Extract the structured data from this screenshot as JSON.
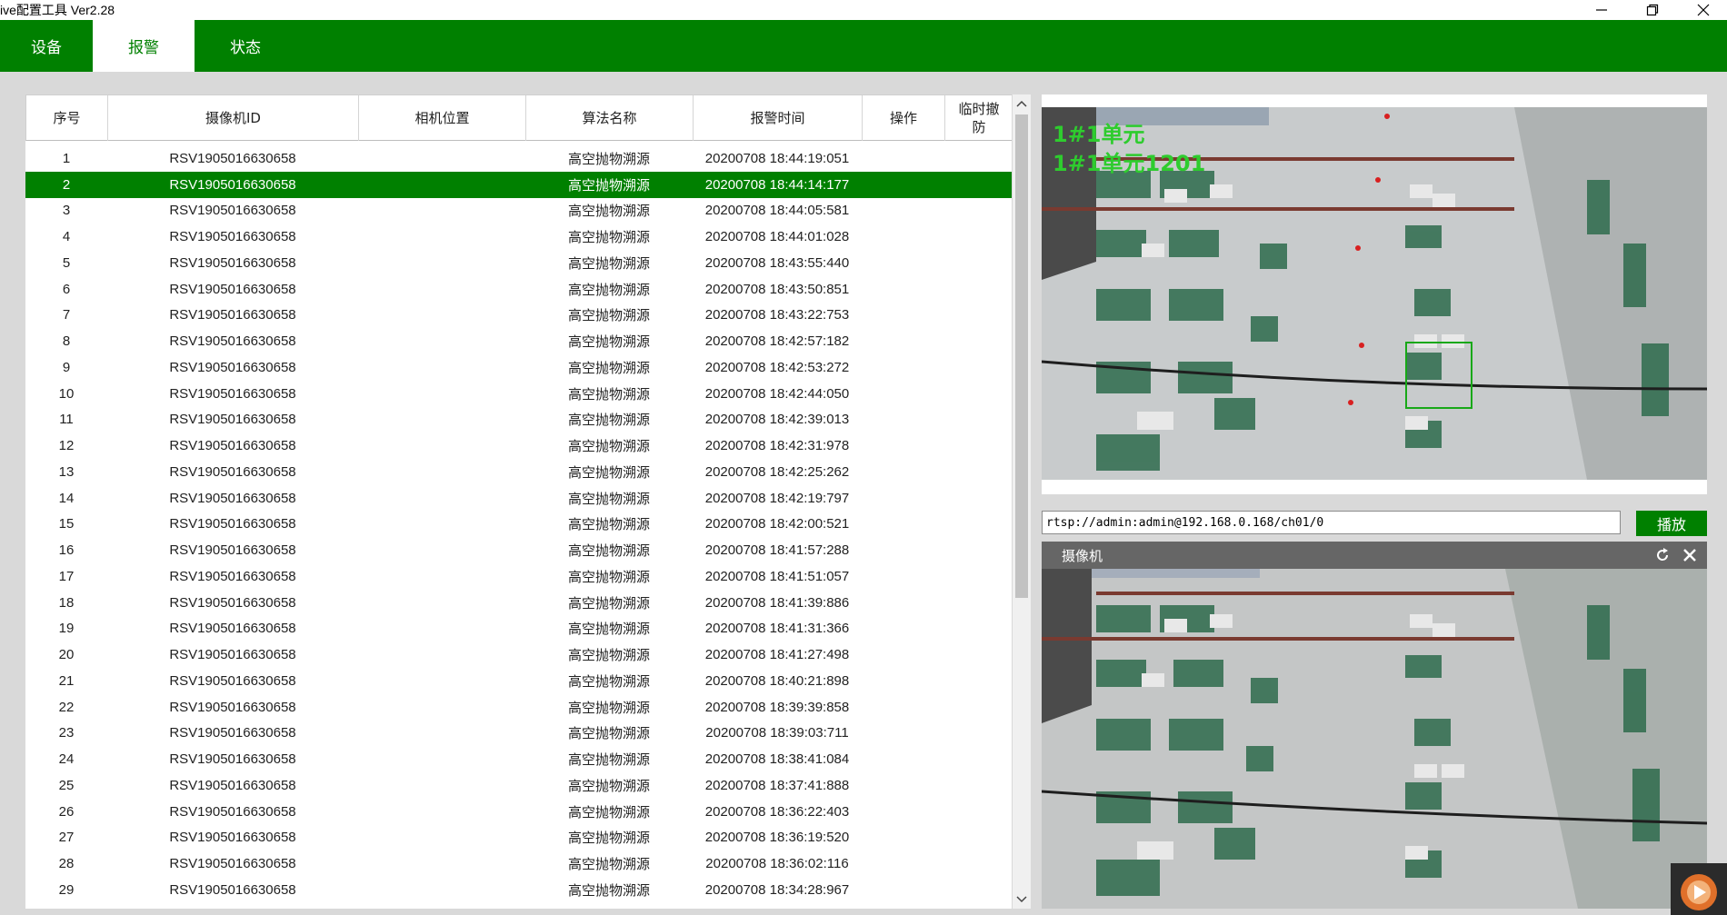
{
  "window": {
    "title": "ive配置工具 Ver2.28",
    "controls": [
      "minimize",
      "restore",
      "close"
    ]
  },
  "tabs": [
    {
      "label": "设备",
      "active": false
    },
    {
      "label": "报警",
      "active": true
    },
    {
      "label": "状态",
      "active": false
    }
  ],
  "table": {
    "columns": [
      "序号",
      "摄像机ID",
      "相机位置",
      "算法名称",
      "报警时间",
      "操作",
      "临时撤防"
    ],
    "selected_row": 2,
    "rows": [
      [
        "1",
        "RSV1905016630658",
        "",
        "高空抛物溯源",
        "20200708 18:44:19:051"
      ],
      [
        "2",
        "RSV1905016630658",
        "",
        "高空抛物溯源",
        "20200708 18:44:14:177"
      ],
      [
        "3",
        "RSV1905016630658",
        "",
        "高空抛物溯源",
        "20200708 18:44:05:581"
      ],
      [
        "4",
        "RSV1905016630658",
        "",
        "高空抛物溯源",
        "20200708 18:44:01:028"
      ],
      [
        "5",
        "RSV1905016630658",
        "",
        "高空抛物溯源",
        "20200708 18:43:55:440"
      ],
      [
        "6",
        "RSV1905016630658",
        "",
        "高空抛物溯源",
        "20200708 18:43:50:851"
      ],
      [
        "7",
        "RSV1905016630658",
        "",
        "高空抛物溯源",
        "20200708 18:43:22:753"
      ],
      [
        "8",
        "RSV1905016630658",
        "",
        "高空抛物溯源",
        "20200708 18:42:57:182"
      ],
      [
        "9",
        "RSV1905016630658",
        "",
        "高空抛物溯源",
        "20200708 18:42:53:272"
      ],
      [
        "10",
        "RSV1905016630658",
        "",
        "高空抛物溯源",
        "20200708 18:42:44:050"
      ],
      [
        "11",
        "RSV1905016630658",
        "",
        "高空抛物溯源",
        "20200708 18:42:39:013"
      ],
      [
        "12",
        "RSV1905016630658",
        "",
        "高空抛物溯源",
        "20200708 18:42:31:978"
      ],
      [
        "13",
        "RSV1905016630658",
        "",
        "高空抛物溯源",
        "20200708 18:42:25:262"
      ],
      [
        "14",
        "RSV1905016630658",
        "",
        "高空抛物溯源",
        "20200708 18:42:19:797"
      ],
      [
        "15",
        "RSV1905016630658",
        "",
        "高空抛物溯源",
        "20200708 18:42:00:521"
      ],
      [
        "16",
        "RSV1905016630658",
        "",
        "高空抛物溯源",
        "20200708 18:41:57:288"
      ],
      [
        "17",
        "RSV1905016630658",
        "",
        "高空抛物溯源",
        "20200708 18:41:51:057"
      ],
      [
        "18",
        "RSV1905016630658",
        "",
        "高空抛物溯源",
        "20200708 18:41:39:886"
      ],
      [
        "19",
        "RSV1905016630658",
        "",
        "高空抛物溯源",
        "20200708 18:41:31:366"
      ],
      [
        "20",
        "RSV1905016630658",
        "",
        "高空抛物溯源",
        "20200708 18:41:27:498"
      ],
      [
        "21",
        "RSV1905016630658",
        "",
        "高空抛物溯源",
        "20200708 18:40:21:898"
      ],
      [
        "22",
        "RSV1905016630658",
        "",
        "高空抛物溯源",
        "20200708 18:39:39:858"
      ],
      [
        "23",
        "RSV1905016630658",
        "",
        "高空抛物溯源",
        "20200708 18:39:03:711"
      ],
      [
        "24",
        "RSV1905016630658",
        "",
        "高空抛物溯源",
        "20200708 18:38:41:084"
      ],
      [
        "25",
        "RSV1905016630658",
        "",
        "高空抛物溯源",
        "20200708 18:37:41:888"
      ],
      [
        "26",
        "RSV1905016630658",
        "",
        "高空抛物溯源",
        "20200708 18:36:22:403"
      ],
      [
        "27",
        "RSV1905016630658",
        "",
        "高空抛物溯源",
        "20200708 18:36:19:520"
      ],
      [
        "28",
        "RSV1905016630658",
        "",
        "高空抛物溯源",
        "20200708 18:36:02:116"
      ],
      [
        "29",
        "RSV1905016630658",
        "",
        "高空抛物溯源",
        "20200708 18:34:28:967"
      ]
    ]
  },
  "snapshot": {
    "overlay_line1": "1#1单元",
    "overlay_line2": "1#1单元1201"
  },
  "stream": {
    "url": "rtsp://admin:admin@192.168.0.168/ch01/0",
    "play_label": "播放"
  },
  "camera_panel": {
    "label": "摄像机",
    "icons": [
      "refresh-icon",
      "close-icon"
    ]
  },
  "colors": {
    "accent": "#008000",
    "overlay_text": "#2ecc2e"
  }
}
